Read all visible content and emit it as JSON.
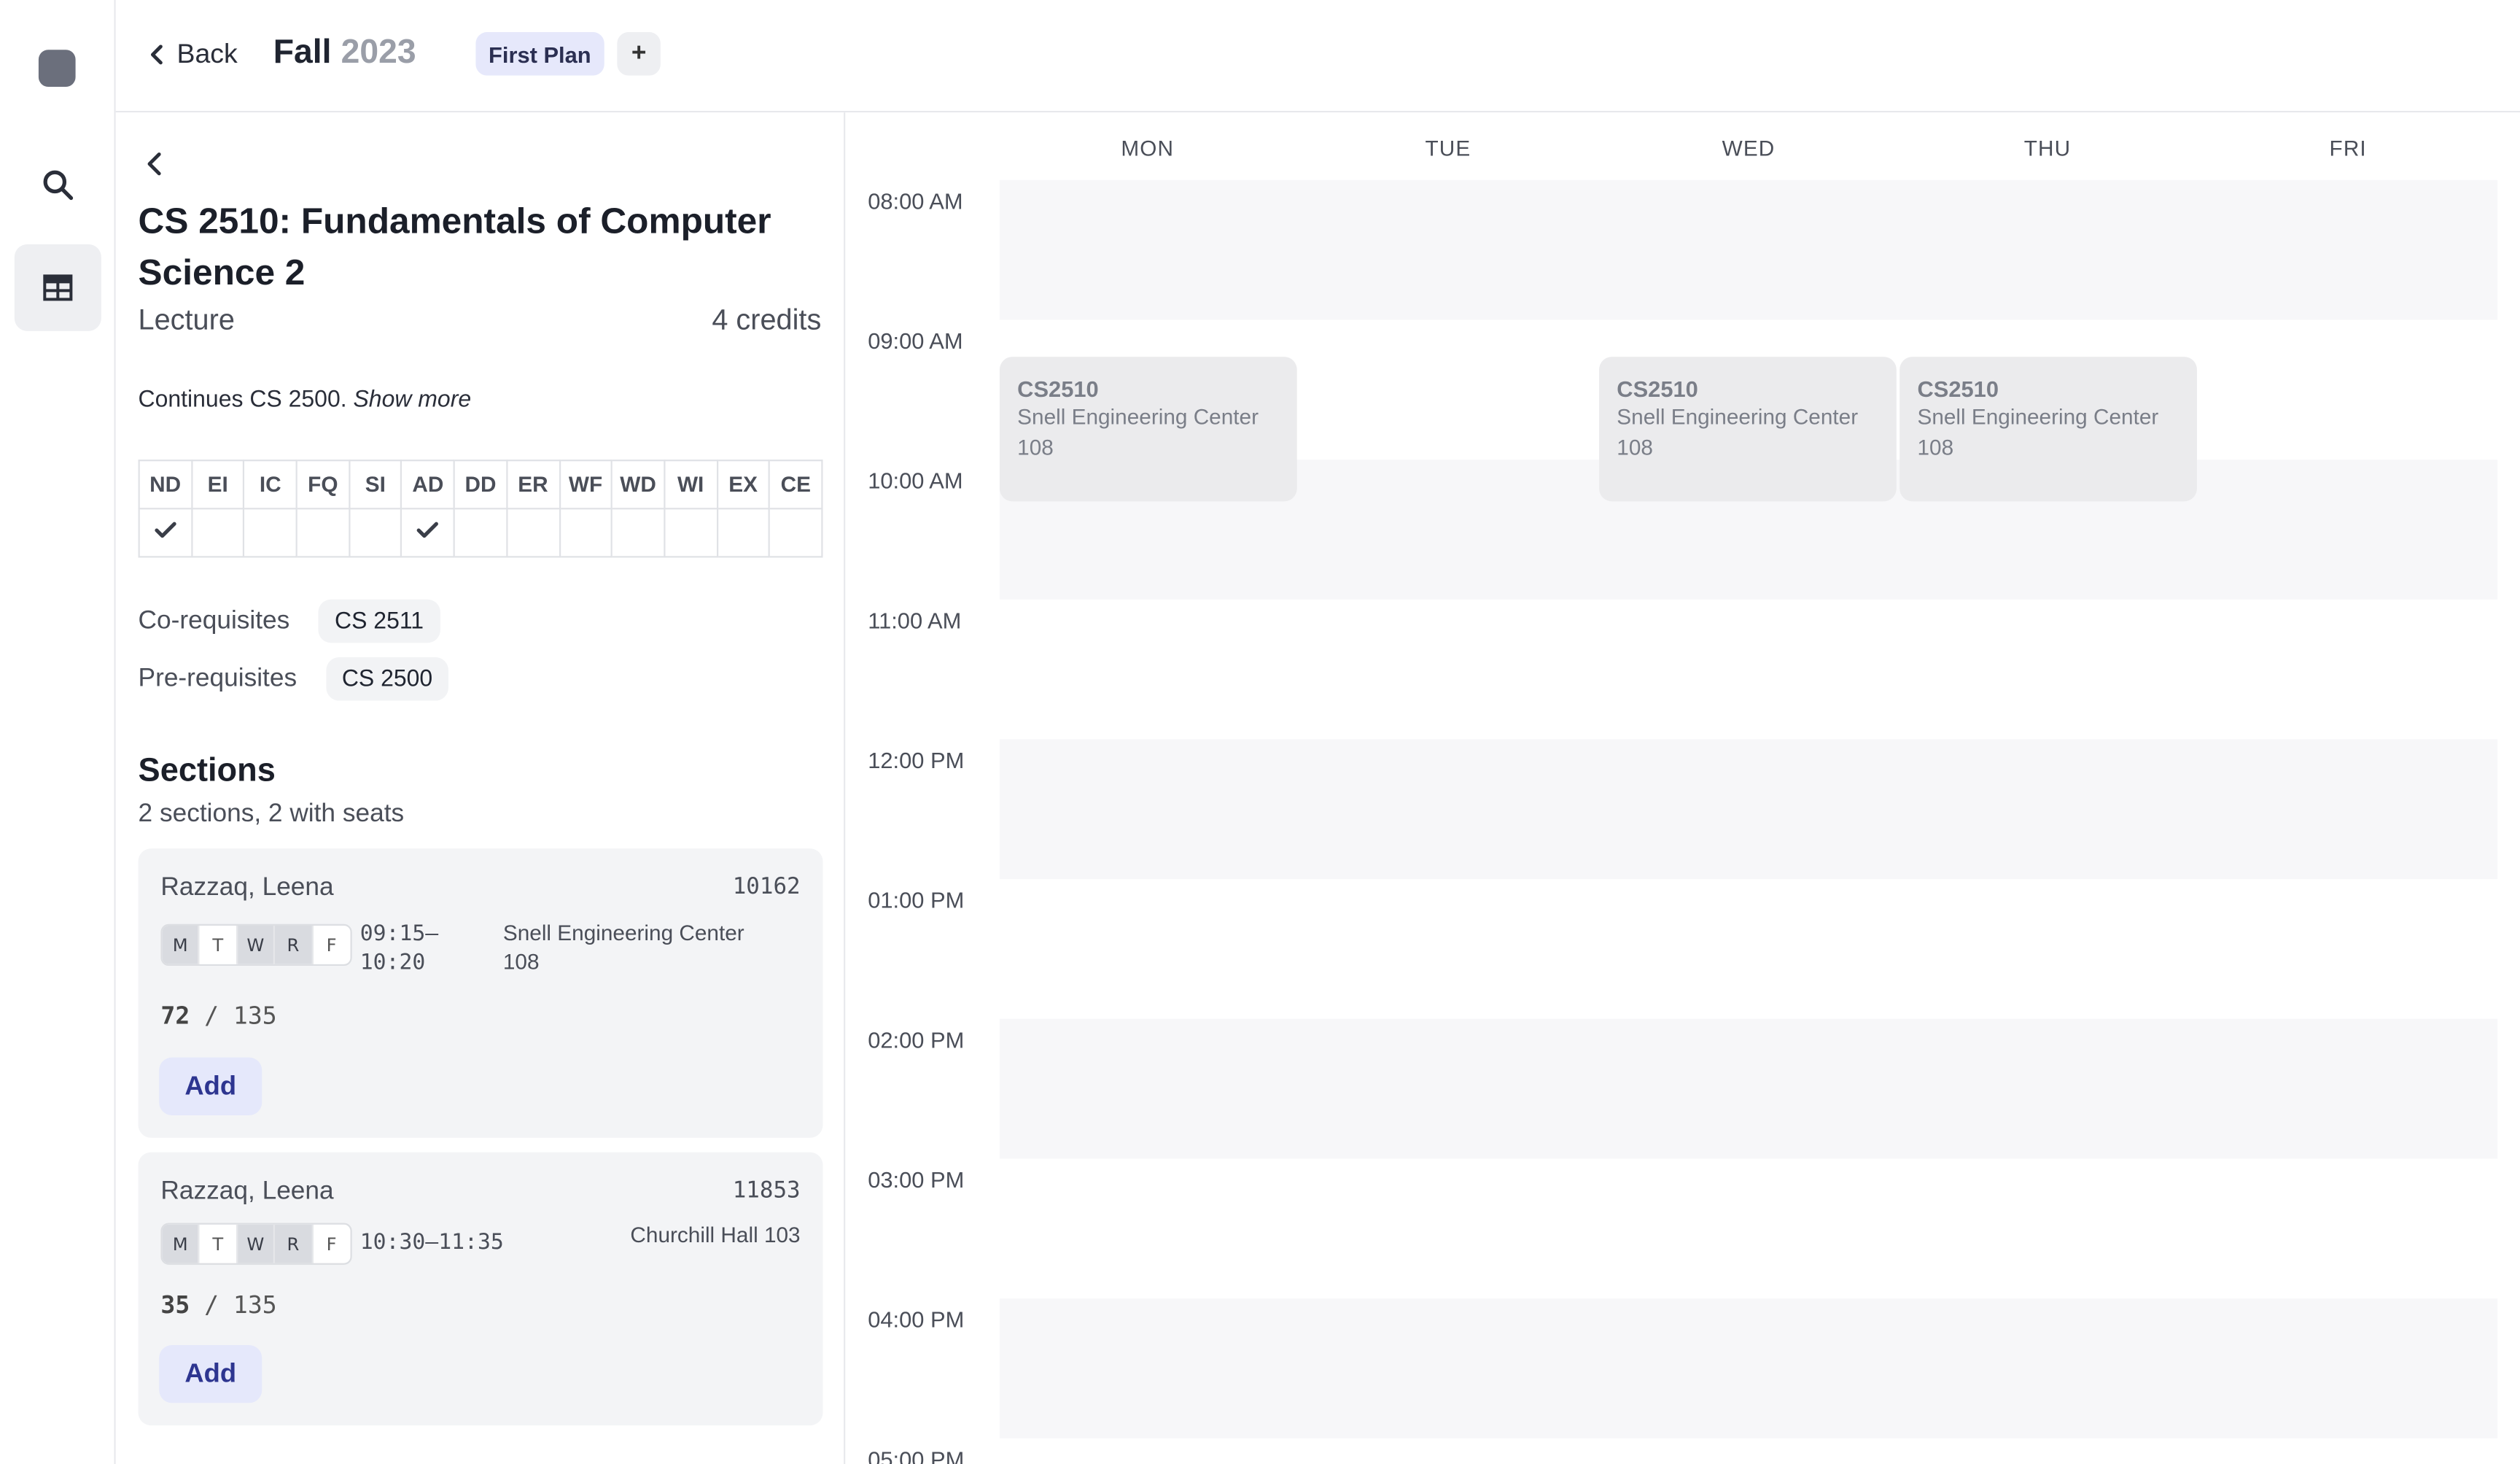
{
  "rail": {
    "items": [
      {
        "name": "search",
        "icon": "search-icon"
      },
      {
        "name": "schedule",
        "icon": "table-icon",
        "active": true
      }
    ]
  },
  "header": {
    "back_label": "Back",
    "term_season": "Fall",
    "term_year": "2023",
    "plan_tab": "First Plan",
    "add_plan_label": "+"
  },
  "course": {
    "title": "CS 2510: Fundamentals of Computer Science 2",
    "type": "Lecture",
    "credits": "4 credits",
    "description": "Continues CS 2500.",
    "show_more": "Show more",
    "attributes": [
      "ND",
      "EI",
      "IC",
      "FQ",
      "SI",
      "AD",
      "DD",
      "ER",
      "WF",
      "WD",
      "WI",
      "EX",
      "CE"
    ],
    "attributes_checked": [
      true,
      false,
      false,
      false,
      false,
      true,
      false,
      false,
      false,
      false,
      false,
      false,
      false
    ],
    "coreq_label": "Co-requisites",
    "coreqs": [
      "CS 2511"
    ],
    "prereq_label": "Pre-requisites",
    "prereqs": [
      "CS 2500"
    ]
  },
  "sections": {
    "heading": "Sections",
    "summary": "2 sections, 2 with seats",
    "items": [
      {
        "instructor": "Razzaq, Leena",
        "crn": "10162",
        "days": [
          "M",
          "T",
          "W",
          "R",
          "F"
        ],
        "days_active": [
          true,
          false,
          true,
          true,
          false
        ],
        "time": "09:15–10:20",
        "time_start": "09:15–",
        "time_end": "10:20",
        "location_line1": "Snell Engineering Center",
        "location_line2": "108",
        "enrolled": "72",
        "capacity": "135",
        "add_label": "Add"
      },
      {
        "instructor": "Razzaq, Leena",
        "crn": "11853",
        "days": [
          "M",
          "T",
          "W",
          "R",
          "F"
        ],
        "days_active": [
          true,
          false,
          true,
          true,
          false
        ],
        "time": "10:30–11:35",
        "location": "Churchill Hall 103",
        "enrolled": "35",
        "capacity": "135",
        "add_label": "Add"
      }
    ]
  },
  "calendar": {
    "days": [
      "MON",
      "TUE",
      "WED",
      "THU",
      "FRI"
    ],
    "times": [
      "08:00 AM",
      "09:00 AM",
      "10:00 AM",
      "11:00 AM",
      "12:00 PM",
      "01:00 PM",
      "02:00 PM",
      "03:00 PM",
      "04:00 PM",
      "05:00 PM"
    ],
    "events": [
      {
        "day": "MON",
        "code": "CS2510",
        "location": "Snell Engineering Center 108",
        "start": "09:15",
        "end": "10:20"
      },
      {
        "day": "WED",
        "code": "CS2510",
        "location": "Snell Engineering Center 108",
        "start": "09:15",
        "end": "10:20"
      },
      {
        "day": "THU",
        "code": "CS2510",
        "location": "Snell Engineering Center 108",
        "start": "09:15",
        "end": "10:20"
      }
    ]
  }
}
